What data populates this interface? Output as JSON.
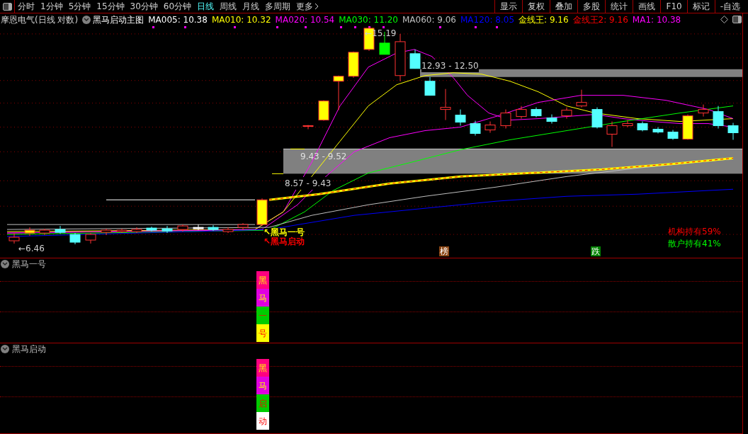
{
  "toolbar": {
    "periods": [
      {
        "label": "分时",
        "selected": false
      },
      {
        "label": "1分钟",
        "selected": false
      },
      {
        "label": "5分钟",
        "selected": false
      },
      {
        "label": "15分钟",
        "selected": false
      },
      {
        "label": "30分钟",
        "selected": false
      },
      {
        "label": "60分钟",
        "selected": false
      },
      {
        "label": "日线",
        "selected": true
      },
      {
        "label": "周线",
        "selected": false
      },
      {
        "label": "月线",
        "selected": false
      },
      {
        "label": "多周期",
        "selected": false
      }
    ],
    "more": "更多",
    "buttons": [
      "显示",
      "复权",
      "叠加",
      "多股",
      "统计",
      "画线",
      "F10",
      "标记",
      "-自选"
    ]
  },
  "legend": {
    "stock": "摩恩电气(日线 对数)",
    "indicator": "黑马启动主图",
    "series": [
      {
        "label": "MA005: 10.38",
        "color": "#ffffff"
      },
      {
        "label": "MA010: 10.32",
        "color": "#ffff00"
      },
      {
        "label": "MA020: 10.54",
        "color": "#ff00ff"
      },
      {
        "label": "MA030: 11.20",
        "color": "#00ff00"
      },
      {
        "label": "MA060: 9.06",
        "color": "#c0c0c0"
      },
      {
        "label": "MA120: 8.05",
        "color": "#0000ff"
      },
      {
        "label": "金线王: 9.16",
        "color": "#ffff00"
      },
      {
        "label": "金线王2: 9.16",
        "color": "#ff0000"
      },
      {
        "label": "MA1: 10.38",
        "color": "#ff00ff"
      }
    ]
  },
  "chart": {
    "high_label": "←15.19",
    "low_label": "←6.46",
    "zones": [
      "12.93 - 12.50",
      "9.43 - 9.52",
      "8.57 - 9.43"
    ],
    "signals": [
      {
        "label": "↖黑马一号",
        "color": "#ffff00"
      },
      {
        "label": "↖黑马启动",
        "color": "#ff0000"
      }
    ],
    "badges": [
      {
        "label": "榜",
        "color": "#8b4513"
      },
      {
        "label": "跌",
        "color": "#008000"
      }
    ],
    "holdings": [
      {
        "label": "机构持有59%",
        "color": "#ff0000"
      },
      {
        "label": "散户持有41%",
        "color": "#00ff00"
      }
    ]
  },
  "panels": [
    {
      "title": "黑马一号",
      "segments": [
        {
          "char": "黑",
          "color": "#ff0080"
        },
        {
          "char": "马",
          "color": "#e000e0"
        },
        {
          "char": "一",
          "color": "#00cc00"
        },
        {
          "char": "号",
          "color": "#ffff00"
        }
      ]
    },
    {
      "title": "黑马启动",
      "segments": [
        {
          "char": "黑",
          "color": "#ff0080"
        },
        {
          "char": "马",
          "color": "#e000e0"
        },
        {
          "char": "启",
          "color": "#00cc00"
        },
        {
          "char": "动",
          "color": "#ffffff"
        }
      ]
    }
  ]
}
